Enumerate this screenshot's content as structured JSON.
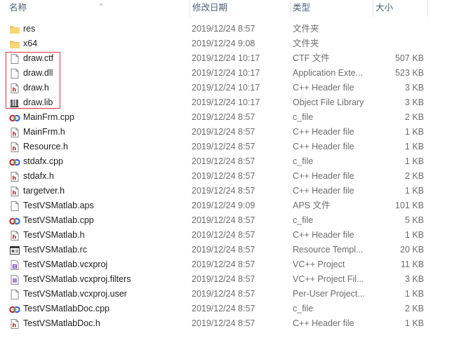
{
  "columns": {
    "name": "名称",
    "date": "修改日期",
    "type": "类型",
    "size": "大小"
  },
  "accent": {
    "selection": "#d9363e",
    "header_text": "#4c607a"
  },
  "files": [
    {
      "name": "res",
      "date": "2019/12/24 8:57",
      "type": "文件夹",
      "size": "",
      "icon": "folder-icon"
    },
    {
      "name": "x64",
      "date": "2019/12/24 9:08",
      "type": "文件夹",
      "size": "",
      "icon": "folder-icon"
    },
    {
      "name": "draw.ctf",
      "date": "2019/12/24 10:17",
      "type": "CTF 文件",
      "size": "507 KB",
      "icon": "blank-file-icon"
    },
    {
      "name": "draw.dll",
      "date": "2019/12/24 10:17",
      "type": "Application Exte...",
      "size": "523 KB",
      "icon": "blank-file-icon"
    },
    {
      "name": "draw.h",
      "date": "2019/12/24 10:17",
      "type": "C++ Header file",
      "size": "3 KB",
      "icon": "header-file-icon"
    },
    {
      "name": "draw.lib",
      "date": "2019/12/24 10:17",
      "type": "Object File Library",
      "size": "3 KB",
      "icon": "library-file-icon"
    },
    {
      "name": "MainFrm.cpp",
      "date": "2019/12/24 8:57",
      "type": "c_file",
      "size": "2 KB",
      "icon": "cpp-file-icon"
    },
    {
      "name": "MainFrm.h",
      "date": "2019/12/24 8:57",
      "type": "C++ Header file",
      "size": "1 KB",
      "icon": "header-file-icon"
    },
    {
      "name": "Resource.h",
      "date": "2019/12/24 8:57",
      "type": "C++ Header file",
      "size": "1 KB",
      "icon": "header-file-icon"
    },
    {
      "name": "stdafx.cpp",
      "date": "2019/12/24 8:57",
      "type": "c_file",
      "size": "1 KB",
      "icon": "cpp-file-icon"
    },
    {
      "name": "stdafx.h",
      "date": "2019/12/24 8:57",
      "type": "C++ Header file",
      "size": "2 KB",
      "icon": "header-file-icon"
    },
    {
      "name": "targetver.h",
      "date": "2019/12/24 8:57",
      "type": "C++ Header file",
      "size": "1 KB",
      "icon": "header-file-icon"
    },
    {
      "name": "TestVSMatlab.aps",
      "date": "2019/12/24 9:09",
      "type": "APS 文件",
      "size": "101 KB",
      "icon": "blank-file-icon"
    },
    {
      "name": "TestVSMatlab.cpp",
      "date": "2019/12/24 8:57",
      "type": "c_file",
      "size": "5 KB",
      "icon": "cpp-file-icon"
    },
    {
      "name": "TestVSMatlab.h",
      "date": "2019/12/24 8:57",
      "type": "C++ Header file",
      "size": "1 KB",
      "icon": "header-file-icon"
    },
    {
      "name": "TestVSMatlab.rc",
      "date": "2019/12/24 8:57",
      "type": "Resource Templ...",
      "size": "20 KB",
      "icon": "resource-file-icon"
    },
    {
      "name": "TestVSMatlab.vcxproj",
      "date": "2019/12/24 8:57",
      "type": "VC++ Project",
      "size": "11 KB",
      "icon": "vcxproj-file-icon"
    },
    {
      "name": "TestVSMatlab.vcxproj.filters",
      "date": "2019/12/24 8:57",
      "type": "VC++ Project Fil...",
      "size": "3 KB",
      "icon": "filters-file-icon"
    },
    {
      "name": "TestVSMatlab.vcxproj.user",
      "date": "2019/12/24 8:57",
      "type": "Per-User Project...",
      "size": "1 KB",
      "icon": "blank-file-icon"
    },
    {
      "name": "TestVSMatlabDoc.cpp",
      "date": "2019/12/24 8:57",
      "type": "c_file",
      "size": "2 KB",
      "icon": "cpp-file-icon"
    },
    {
      "name": "TestVSMatlabDoc.h",
      "date": "2019/12/24 8:57",
      "type": "C++ Header file",
      "size": "1 KB",
      "icon": "header-file-icon"
    }
  ]
}
